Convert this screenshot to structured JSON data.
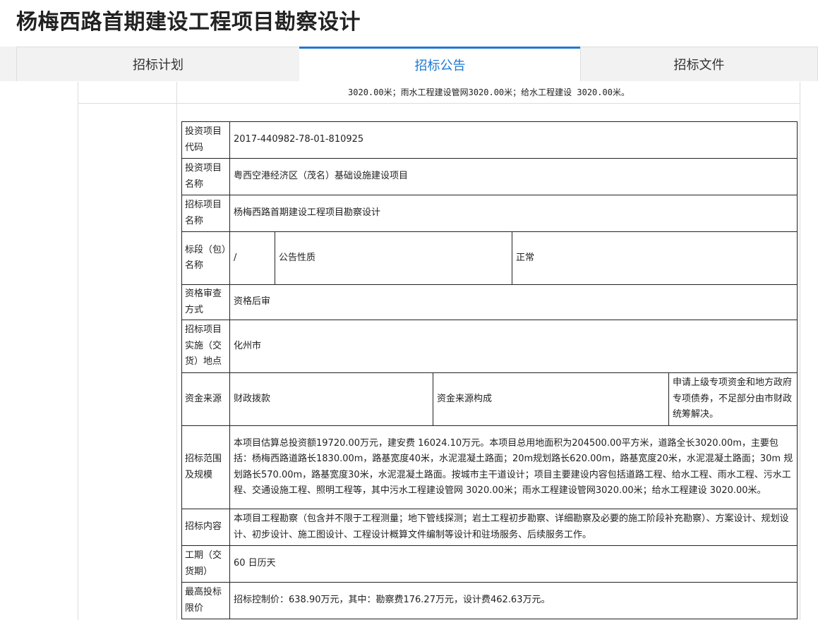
{
  "page": {
    "title": "杨梅西路首期建设工程项目勘察设计"
  },
  "tabs": [
    {
      "label": "招标计划"
    },
    {
      "label": "招标公告"
    },
    {
      "label": "招标文件"
    }
  ],
  "previous_row_text": "3020.00米；雨水工程建设管网3020.00米；给水工程建设 3020.00米。",
  "table": {
    "investment_code": {
      "label": "投资项目代码",
      "value": "2017-440982-78-01-810925"
    },
    "investment_name": {
      "label": "投资项目名称",
      "value": "粤西空港经济区（茂名）基础设施建设项目"
    },
    "tender_name": {
      "label": "招标项目名称",
      "value": "杨梅西路首期建设工程项目勘察设计"
    },
    "section": {
      "label": "标段（包）名称",
      "value": "/",
      "nature_label": "公告性质",
      "nature_value": "正常"
    },
    "qualification": {
      "label": "资格审查方式",
      "value": "资格后审"
    },
    "location": {
      "label": "招标项目实施（交货）地点",
      "value": "化州市"
    },
    "funding": {
      "label": "资金来源",
      "value": "财政拨款",
      "structure_label": "资金来源构成",
      "structure_value": "申请上级专项资金和地方政府专项债券，不足部分由市财政统筹解决。"
    },
    "scope": {
      "label": "招标范围及规模",
      "value": "本项目估算总投资额19720.00万元，建安费 16024.10万元。本项目总用地面积为204500.00平方米，道路全长3020.00m，主要包括：杨梅西路道路长1830.00m，路基宽度40米，水泥混凝土路面；20m规划路长620.00m，路基宽度20米，水泥混凝土路面；30m 规划路长570.00m，路基宽度30米，水泥混凝土路面。按城市主干道设计；项目主要建设内容包括道路工程、给水工程、雨水工程、污水工程、交通设施工程、照明工程等，其中污水工程建设管网 3020.00米；雨水工程建设管网3020.00米；给水工程建设 3020.00米。"
    },
    "content": {
      "label": "招标内容",
      "value": "本项目工程勘察（包含并不限于工程测量；地下管线探测；岩土工程初步勘察、详细勘察及必要的施工阶段补充勘察）、方案设计、规划设计、初步设计、施工图设计、工程设计概算文件编制等设计和驻场服务、后续服务工作。"
    },
    "duration": {
      "label": "工期（交货期）",
      "value": "60 日历天"
    },
    "max_price": {
      "label": "最高投标限价",
      "value": "招标控制价：638.90万元，其中：勘察费176.27万元，设计费462.63万元。"
    }
  },
  "colors": {
    "accent": "#1e78d2",
    "tab_bg": "#f2f2f2",
    "border": "#dcdcdc"
  }
}
